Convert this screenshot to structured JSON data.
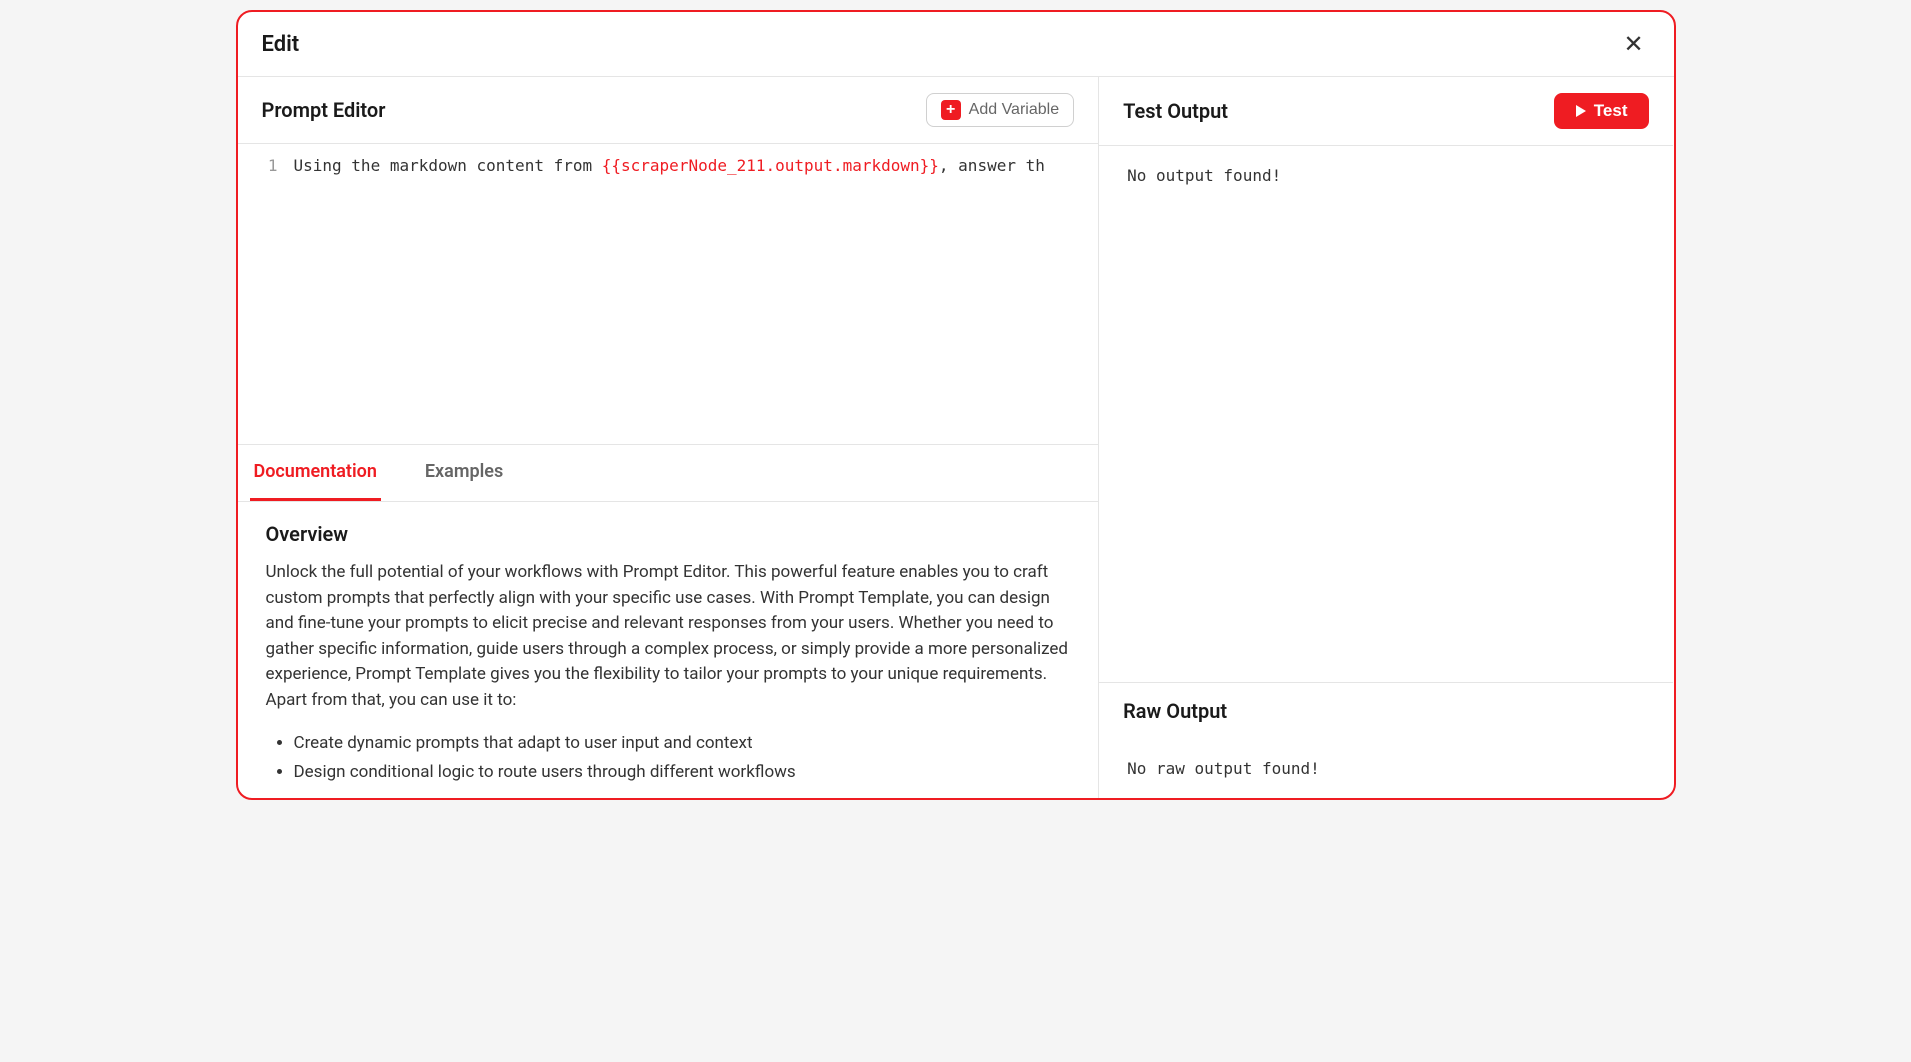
{
  "modal": {
    "title": "Edit"
  },
  "editor": {
    "title": "Prompt Editor",
    "add_variable_label": "Add Variable",
    "code": {
      "line_number": "1",
      "prefix": "Using the markdown content from ",
      "variable": "{{scraperNode_211.output.markdown}}",
      "suffix": ", answer th"
    }
  },
  "test_output": {
    "title": "Test Output",
    "test_button": "Test",
    "content": "No output found!"
  },
  "tabs": {
    "documentation": "Documentation",
    "examples": "Examples"
  },
  "documentation": {
    "heading": "Overview",
    "paragraph": "Unlock the full potential of your workflows with Prompt Editor. This powerful feature enables you to craft custom prompts that perfectly align with your specific use cases. With Prompt Template, you can design and fine-tune your prompts to elicit precise and relevant responses from your users. Whether you need to gather specific information, guide users through a complex process, or simply provide a more personalized experience, Prompt Template gives you the flexibility to tailor your prompts to your unique requirements. Apart from that, you can use it to:",
    "bullets": [
      "Create dynamic prompts that adapt to user input and context",
      "Design conditional logic to route users through different workflows"
    ]
  },
  "raw_output": {
    "title": "Raw Output",
    "content": "No raw output found!"
  }
}
